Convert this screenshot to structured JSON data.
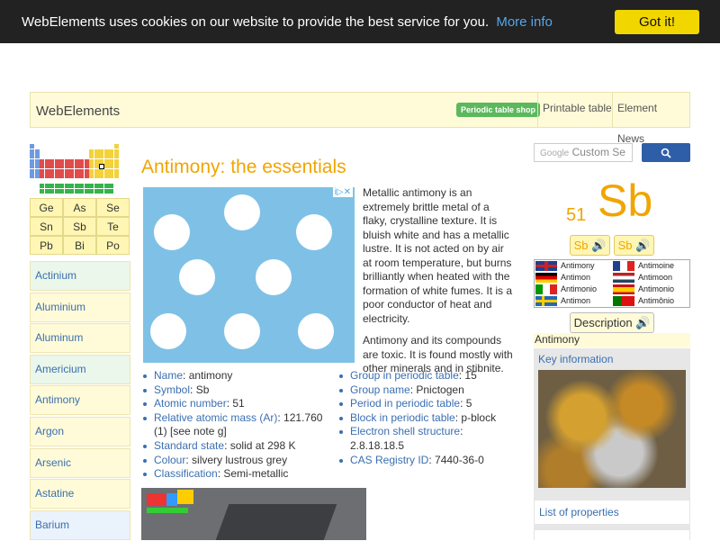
{
  "cookie": {
    "message": "WebElements uses cookies on our website to provide the best service for you.",
    "more_link": "More info",
    "accept": "Got it!"
  },
  "header": {
    "brand": "WebElements",
    "shop": "Periodic table shop",
    "nav": [
      "Printable table",
      "Element News"
    ]
  },
  "mini_table": [
    [
      "Ge",
      "As",
      "Se"
    ],
    [
      "Sn",
      "Sb",
      "Te"
    ],
    [
      "Pb",
      "Bi",
      "Po"
    ]
  ],
  "element_list": [
    "Actinium",
    "Aluminium",
    "Aluminum",
    "Americium",
    "Antimony",
    "Argon",
    "Arsenic",
    "Astatine",
    "Barium"
  ],
  "page_title": "Antimony: the essentials",
  "ad_badge": "i▷✕",
  "description": [
    "Metallic antimony is an extremely brittle metal of a flaky, crystalline texture. It is bluish white and has a metallic lustre. It is not acted on by air at room temperature, but burns brilliantly when heated with the formation of white fumes. It is a poor conductor of heat and electricity.",
    "Antimony and its compounds are toxic. It is found mostly with other minerals and in stibnite."
  ],
  "facts_left": [
    {
      "label": "Name",
      "value": "antimony"
    },
    {
      "label": "Symbol",
      "value": "Sb"
    },
    {
      "label": "Atomic number",
      "value": "51"
    },
    {
      "label": "Relative atomic mass (Ar)",
      "value": "121.760 (1) [see note g]"
    },
    {
      "label": "Standard state",
      "value": "solid at 298 K"
    },
    {
      "label": "Colour",
      "value": "silvery lustrous grey"
    },
    {
      "label": "Classification",
      "value": "Semi-metallic"
    }
  ],
  "facts_right": [
    {
      "label": "Group in periodic table",
      "value": "15"
    },
    {
      "label": "Group name",
      "value": "Pnictogen"
    },
    {
      "label": "Period in periodic table",
      "value": "5"
    },
    {
      "label": "Block in periodic table",
      "value": "p-block"
    },
    {
      "label": "Electron shell structure",
      "value": "2.8.18.18.5"
    },
    {
      "label": "CAS Registry ID",
      "value": "7440-36-0"
    }
  ],
  "search": {
    "placeholder": "Custom Se",
    "google": "Google",
    "icon": "search-icon"
  },
  "element": {
    "number": "51",
    "symbol": "Sb"
  },
  "audio_buttons": [
    "Sb 🔊",
    "Sb 🔊"
  ],
  "languages": [
    {
      "name": "Antimony",
      "flag": "uk"
    },
    {
      "name": "Antimoine",
      "flag": "fr"
    },
    {
      "name": "Antimon",
      "flag": "de"
    },
    {
      "name": "Antimoon",
      "flag": "nl"
    },
    {
      "name": "Antimonio",
      "flag": "it"
    },
    {
      "name": "Antimonio",
      "flag": "es"
    },
    {
      "name": "Antimon",
      "flag": "se"
    },
    {
      "name": "Antimônio",
      "flag": "pt"
    }
  ],
  "description_button": "Description 🔊",
  "right_label": "Antimony",
  "right_links": [
    "Key information",
    "List of properties"
  ],
  "colors": {
    "accent": "#f0a500",
    "link": "#3a6fb0",
    "cookie_bg": "#222222",
    "cookie_button": "#f1d600"
  }
}
